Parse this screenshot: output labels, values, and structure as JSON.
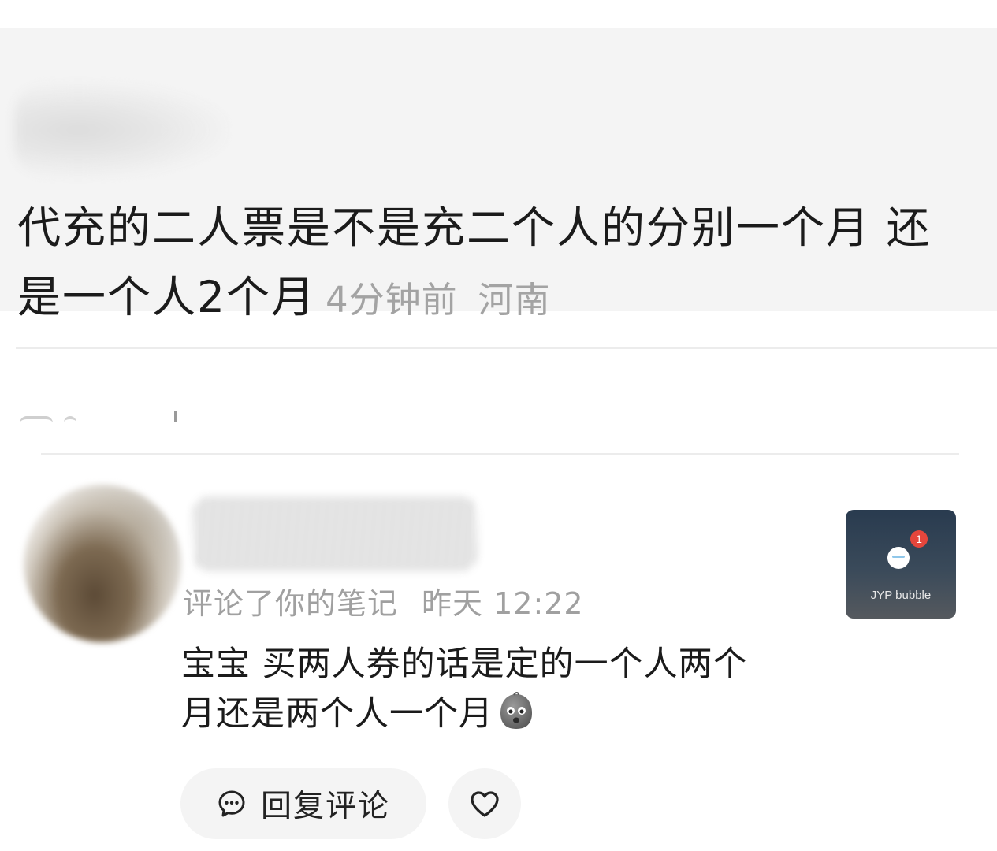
{
  "note": {
    "text": "代充的二人票是不是充二个人的分别一个月 还是一个人2个月",
    "time": "4分钟前",
    "location": "河南"
  },
  "comment": {
    "action": "评论了你的笔记",
    "time": "昨天 12:22",
    "text": "宝宝 买两人券的话是定的一个人两个月还是两个人一个月",
    "emoji": "ghost-face-emoji"
  },
  "thumbnail": {
    "label": "JYP bubble",
    "badge": "1"
  },
  "actions": {
    "reply_label": "回复评论",
    "reply_icon": "chat-bubble-icon",
    "like_icon": "heart-icon"
  },
  "colors": {
    "meta_gray": "#a0a0a0",
    "card_bg": "#f4f4f4",
    "badge_red": "#e5463c"
  }
}
